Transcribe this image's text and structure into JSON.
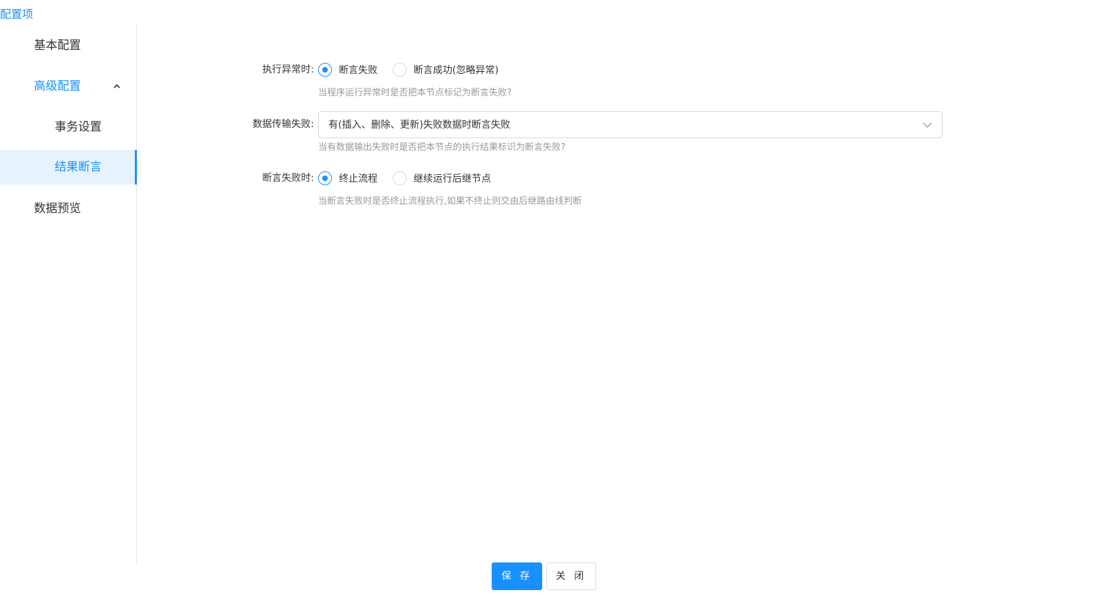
{
  "sidebar": {
    "title": "配置项",
    "items": [
      {
        "label": "基本配置"
      },
      {
        "label": "高级配置",
        "expanded": true,
        "children": [
          {
            "label": "事务设置"
          },
          {
            "label": "结果断言",
            "selected": true
          }
        ]
      },
      {
        "label": "数据预览"
      }
    ]
  },
  "form": {
    "exception": {
      "label": "执行异常时:",
      "options": [
        "断言失败",
        "断言成功(忽略异常)"
      ],
      "selected": "断言失败",
      "help": "当程序运行异常时是否把本节点标记为断言失败?"
    },
    "transfer_failure": {
      "label": "数据传输失败:",
      "value": "有(插入、删除、更新)失败数据时断言失败",
      "help": "当有数据输出失败时是否把本节点的执行结果标识为断言失败?"
    },
    "assert_failure": {
      "label": "断言失败时:",
      "options": [
        "终止流程",
        "继续运行后继节点"
      ],
      "selected": "终止流程",
      "help": "当断言失败时是否终止流程执行,如果不终止则交由后继路由线判断"
    }
  },
  "footer": {
    "save_label": "保 存",
    "close_label": "关 闭"
  },
  "colors": {
    "accent": "#1890ff",
    "selected_bg": "#e6f3ff",
    "help_text": "#999999"
  }
}
